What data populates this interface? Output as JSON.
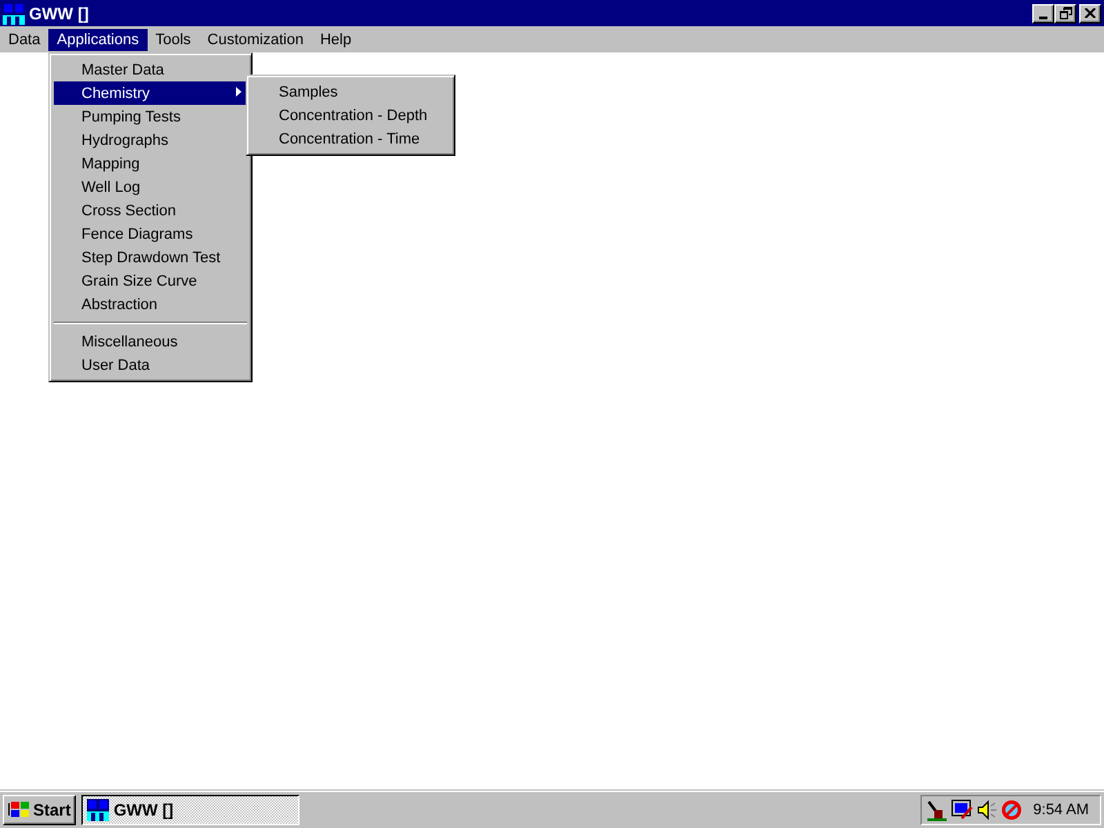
{
  "window": {
    "title": "GWW []"
  },
  "menu_bar": [
    {
      "label": "Data",
      "selected": false
    },
    {
      "label": "Applications",
      "selected": true
    },
    {
      "label": "Tools",
      "selected": false
    },
    {
      "label": "Customization",
      "selected": false
    },
    {
      "label": "Help",
      "selected": false
    }
  ],
  "menu": {
    "items": [
      {
        "kind": "item",
        "label": "Master Data",
        "selected": false
      },
      {
        "kind": "submenu",
        "label": "Chemistry",
        "selected": true
      },
      {
        "kind": "item",
        "label": "Pumping Tests",
        "selected": false
      },
      {
        "kind": "item",
        "label": "Hydrographs",
        "selected": false
      },
      {
        "kind": "item",
        "label": "Mapping",
        "selected": false
      },
      {
        "kind": "item",
        "label": "Well Log",
        "selected": false
      },
      {
        "kind": "item",
        "label": "Cross Section",
        "selected": false
      },
      {
        "kind": "item",
        "label": "Fence Diagrams",
        "selected": false
      },
      {
        "kind": "item",
        "label": "Step Drawdown Test",
        "selected": false
      },
      {
        "kind": "item",
        "label": "Grain Size Curve",
        "selected": false
      },
      {
        "kind": "item",
        "label": "Abstraction",
        "selected": false
      },
      {
        "kind": "separator"
      },
      {
        "kind": "item",
        "label": "Miscellaneous",
        "selected": false
      },
      {
        "kind": "item",
        "label": "User Data",
        "selected": false
      }
    ]
  },
  "submenu": {
    "items": [
      {
        "kind": "item",
        "label": "Samples",
        "selected": false
      },
      {
        "kind": "item",
        "label": "Concentration - Depth",
        "selected": false
      },
      {
        "kind": "item",
        "label": "Concentration - Time",
        "selected": false
      }
    ]
  },
  "taskbar": {
    "start": "Start",
    "tasks": [
      {
        "label": "GWW []",
        "selected": true
      }
    ],
    "clock": "9:54 AM"
  }
}
